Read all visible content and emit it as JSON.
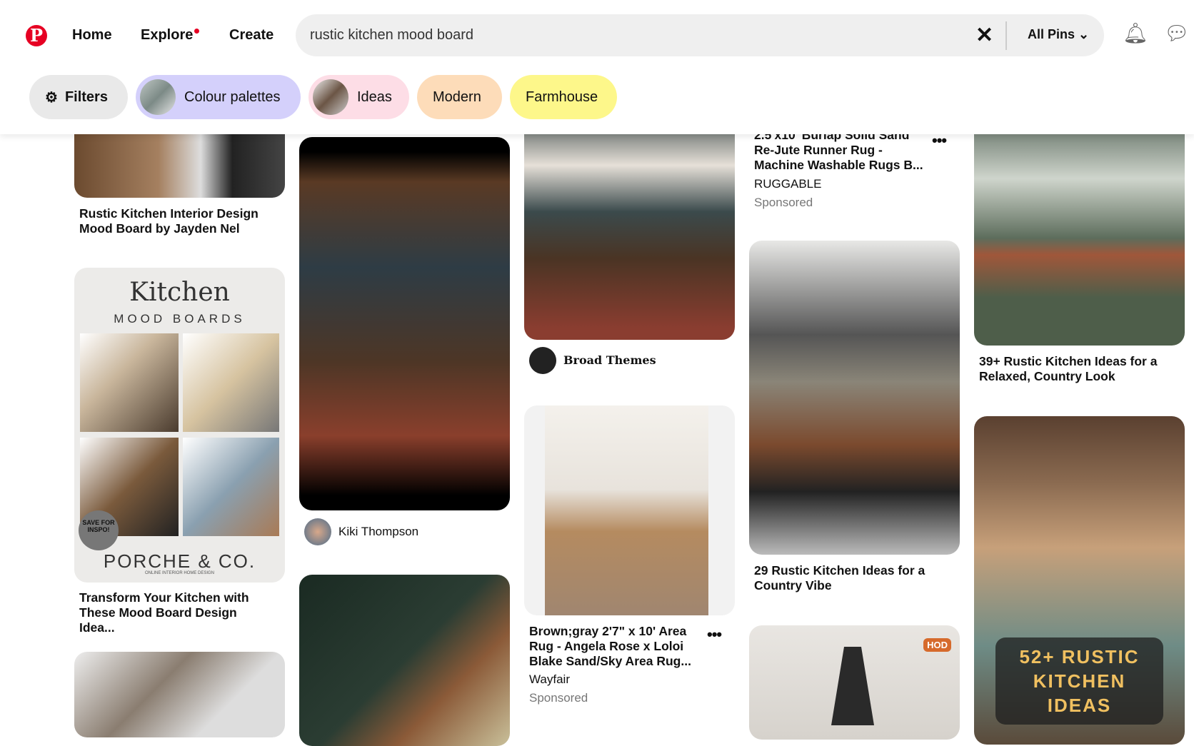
{
  "header": {
    "logo": "Pinterest",
    "nav": [
      "Home",
      "Explore",
      "Create"
    ],
    "explore_has_notification": true,
    "search": {
      "value": "rustic kitchen mood board",
      "scope": "All Pins"
    },
    "icons": [
      "bell-icon",
      "chat-icon"
    ]
  },
  "chips": [
    {
      "label": "Filters",
      "color": "#e9e9e9"
    },
    {
      "label": "Colour palettes",
      "color": "#d4d0fb"
    },
    {
      "label": "Ideas",
      "color": "#fddde6"
    },
    {
      "label": "Modern",
      "color": "#fddcb9"
    },
    {
      "label": "Farmhouse",
      "color": "#fdf78a"
    }
  ],
  "pins": {
    "c1": [
      {
        "title": "Rustic Kitchen Interior Design Mood Board by Jayden Nel"
      },
      {
        "title": "Transform Your Kitchen with These Mood Board Design Idea...",
        "image_text": {
          "heading": "Kitchen",
          "sub": "MOOD BOARDS",
          "badge": "SAVE FOR INSPO!",
          "brand": "PORCHE & CO.",
          "tagline": "ONLINE INTERIOR HOME DESIGN"
        }
      }
    ],
    "c2": [
      {
        "author": "Kiki Thompson"
      }
    ],
    "c3": [
      {
        "author": "Broad Themes"
      },
      {
        "title": "Brown;gray 2'7\" x 10' Area Rug - Angela Rose x Loloi Blake Sand/Sky Area Rug...",
        "seller": "Wayfair",
        "sponsored": "Sponsored"
      }
    ],
    "c4": [
      {
        "title": "2.5'x10' Burlap Solid Sand Re-Jute Runner Rug - Machine Washable Rugs B...",
        "seller": "RUGGABLE",
        "sponsored": "Sponsored"
      },
      {
        "title": "29 Rustic Kitchen Ideas for a Country Vibe"
      },
      {
        "image_text": "HOD"
      }
    ],
    "c5": [
      {
        "title": "39+ Rustic Kitchen Ideas for a Relaxed, Country Look"
      },
      {
        "image_text": "52+ RUSTIC KITCHEN IDEAS"
      }
    ]
  }
}
